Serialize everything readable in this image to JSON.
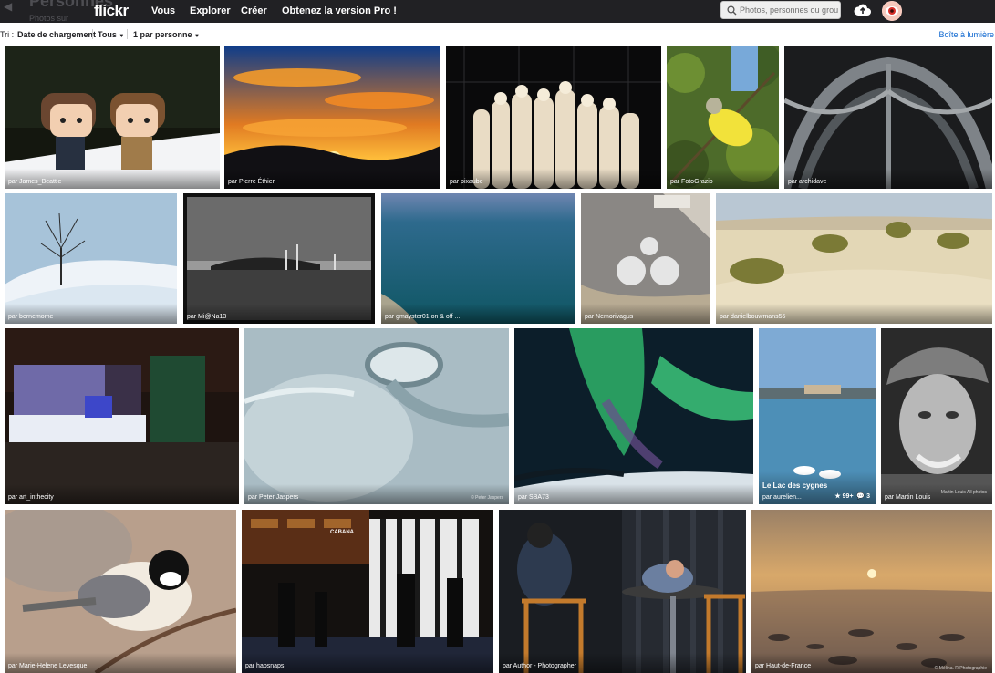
{
  "header": {
    "ghost_title": "Personnes",
    "ghost_subtitle": "Photos sur",
    "logo": "flickr",
    "nav": [
      "Vous",
      "Explorer",
      "Créer",
      "Obtenez la version Pro !"
    ],
    "search_placeholder": "Photos, personnes ou groupes"
  },
  "sortbar": {
    "label": "Tri :",
    "sort_by": "Date de chargement",
    "filter": "Tous",
    "per_person": "1 par personne",
    "lightbox": "Boîte à lumière"
  },
  "colors": {
    "topbar": "#212124",
    "link_blue": "#1169d0",
    "logo_pink": "#ff0084",
    "logo_blue": "#0063dc"
  },
  "icons": [
    "back-arrow-icon",
    "search-icon",
    "upload-cloud-icon",
    "chevron-down-icon",
    "star-icon",
    "comment-icon"
  ],
  "photos": [
    {
      "author": "par James_Beattie"
    },
    {
      "author": "par Pierre Éthier"
    },
    {
      "author": "par pixaube"
    },
    {
      "author": "par FotoGrazio"
    },
    {
      "author": "par archidave"
    },
    {
      "author": "par bernemome"
    },
    {
      "author": "par Mi@Na13"
    },
    {
      "author": "par gmayster01 on & off ..."
    },
    {
      "author": "par Nemorivagus"
    },
    {
      "author": "par danielbouwmans55"
    },
    {
      "author": "par art_inthecity"
    },
    {
      "author": "par Peter Jaspers",
      "watermark": "© Peter Jaspers"
    },
    {
      "author": "par SBA73"
    },
    {
      "author": "par aurelien...",
      "title": "Le Lac des cygnes",
      "faves": "99+",
      "comments": "3"
    },
    {
      "author": "par Martin Louis",
      "watermark": "Martin Louis All photos"
    },
    {
      "author": "par Marie-Helene Levesque"
    },
    {
      "author": "par hapsnaps",
      "sign": "CABANA"
    },
    {
      "author": "par Author - Photographer"
    },
    {
      "author": "par Haut-de-France",
      "watermark": "© Mélina. R Photographie"
    }
  ]
}
